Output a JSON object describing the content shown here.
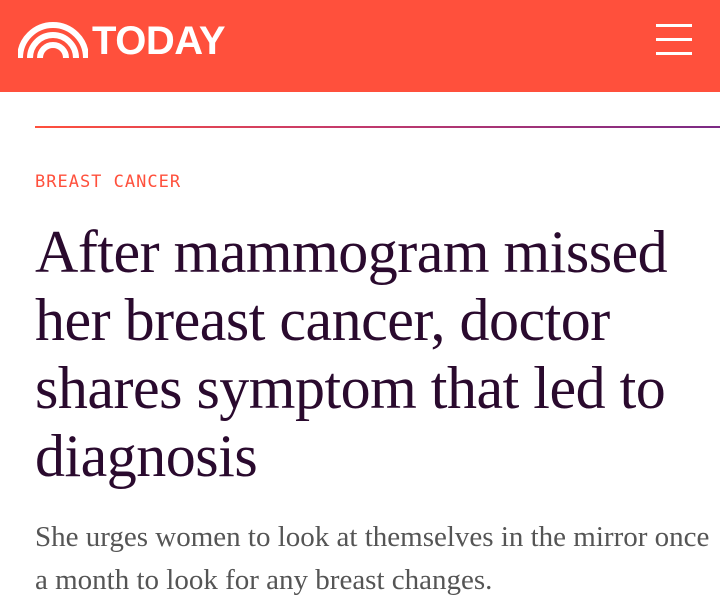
{
  "header": {
    "brand": "TODAY",
    "background_color": "#ff503c",
    "logo_icon": "rainbow-logo-icon",
    "menu_icon": "hamburger-menu-icon"
  },
  "article": {
    "category": "BREAST CANCER",
    "category_color": "#ff503c",
    "headline": "After mammogram missed her breast cancer, doctor shares symptom that led to diagnosis",
    "headline_color": "#2a0a2e",
    "dek": "She urges women to look at themselves in the mirror once a month to look for any breast changes."
  }
}
